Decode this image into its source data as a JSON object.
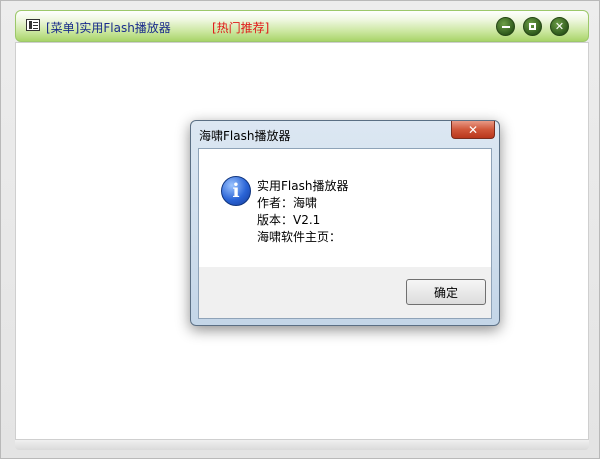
{
  "app": {
    "menu_label": "[菜单]实用Flash播放器",
    "hot_label": "[热门推荐]",
    "controls": {
      "minimize_icon": "minimize-icon",
      "maximize_icon": "maximize-icon",
      "close_glyph": "✕"
    },
    "accent_color": "#a9d46a"
  },
  "dialog": {
    "title": "海啸Flash播放器",
    "close_glyph": "✕",
    "icon": "info-icon",
    "icon_glyph": "i",
    "lines": [
      "实用Flash播放器",
      "作者：海啸",
      "版本：V2.1",
      "海啸软件主页："
    ],
    "ok_label": "确定"
  }
}
